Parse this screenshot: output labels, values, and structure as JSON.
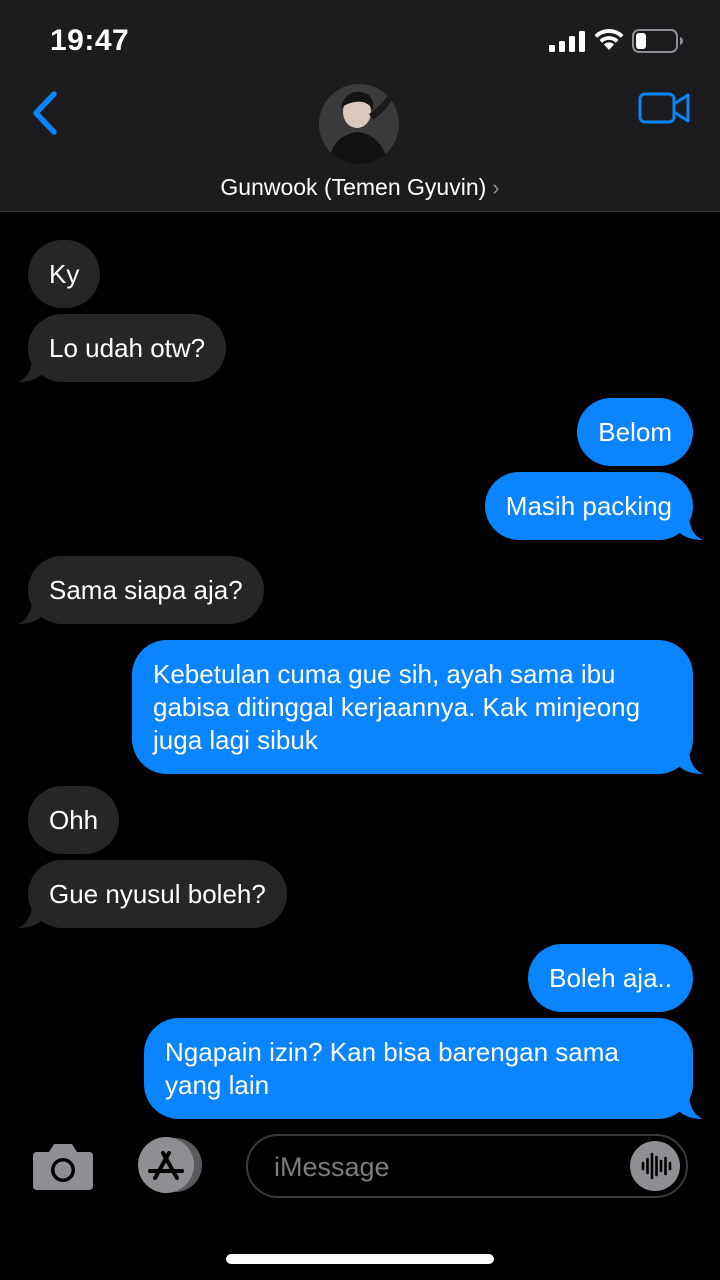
{
  "status_bar": {
    "time": "19:47",
    "icons": [
      "cellular-signal-icon",
      "wifi-icon",
      "battery-low-icon"
    ]
  },
  "header": {
    "back_icon": "chevron-left-icon",
    "contact_name": "Gunwook (Temen Gyuvin)",
    "chevron": "›",
    "video_icon": "video-camera-icon"
  },
  "messages": [
    {
      "direction": "in",
      "text": "Ky"
    },
    {
      "direction": "in",
      "text": "Lo udah otw?"
    },
    {
      "direction": "out",
      "text": "Belom"
    },
    {
      "direction": "out",
      "text": "Masih packing"
    },
    {
      "direction": "in",
      "text": "Sama siapa aja?"
    },
    {
      "direction": "out",
      "text": "Kebetulan cuma gue sih, ayah sama ibu gabisa ditinggal kerjaannya. Kak minjeong juga lagi sibuk"
    },
    {
      "direction": "in",
      "text": "Ohh"
    },
    {
      "direction": "in",
      "text": "Gue nyusul boleh?"
    },
    {
      "direction": "out",
      "text": "Boleh aja.."
    },
    {
      "direction": "out",
      "text": "Ngapain izin? Kan bisa barengan sama yang lain"
    }
  ],
  "input_bar": {
    "camera_icon": "camera-icon",
    "apps_icon": "app-store-icon",
    "placeholder": "iMessage",
    "audio_icon": "audio-waveform-icon"
  },
  "colors": {
    "outgoing_bubble": "#0a84ff",
    "incoming_bubble": "#262628",
    "header_bg": "#1c1c1e",
    "accent": "#0a84ff"
  }
}
